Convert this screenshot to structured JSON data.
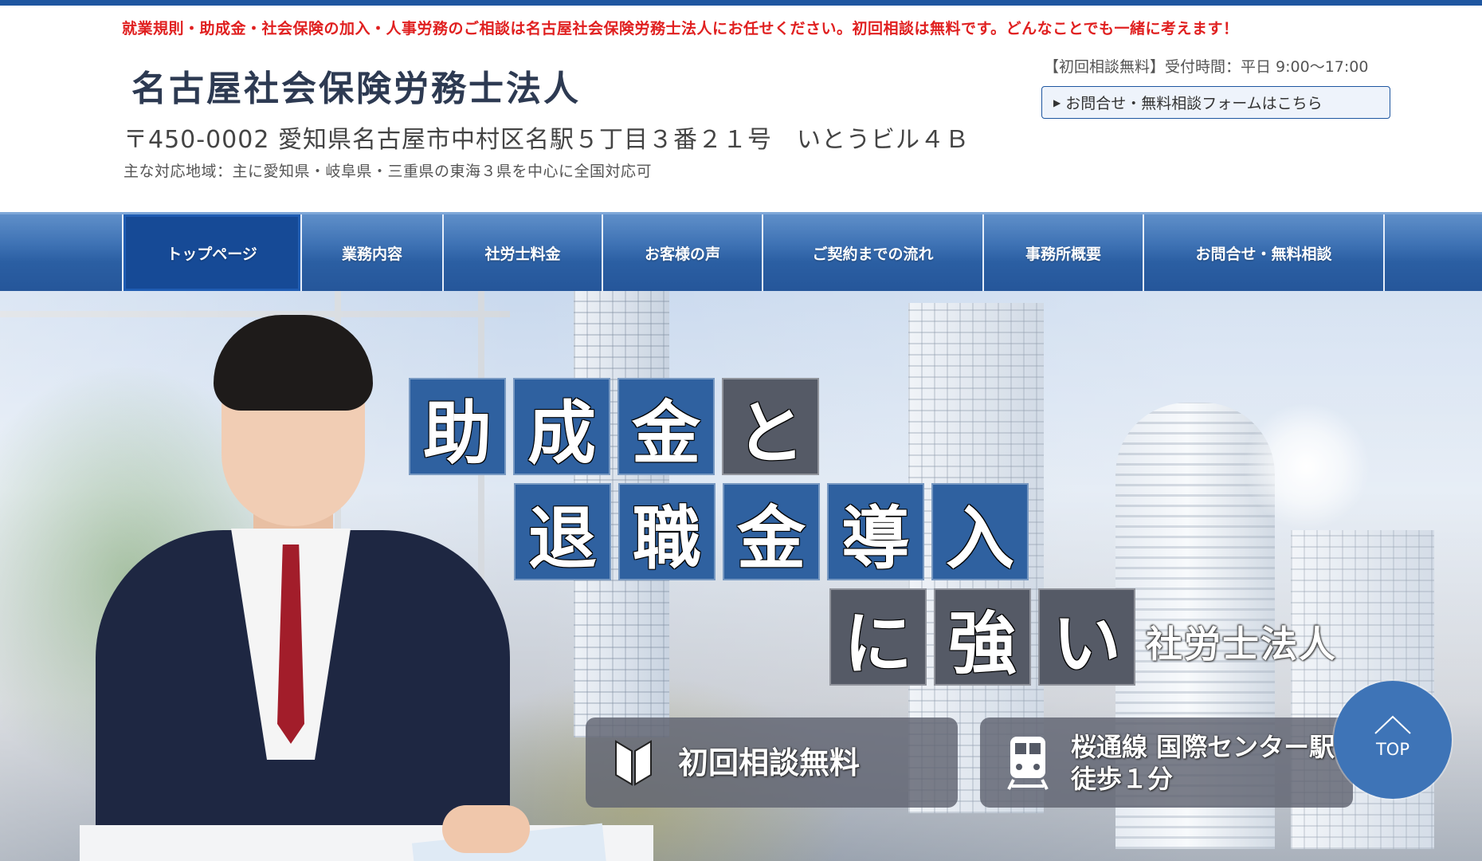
{
  "header": {
    "notice": "就業規則・助成金・社会保険の加入・人事労務のご相談は名古屋社会保険労務士法人にお任せください。初回相談は無料です。どんなことでも一緒に考えます！",
    "logo": "名古屋社会保険労務士法人",
    "address": "〒450-0002 愛知県名古屋市中村区名駅５丁目３番２１号　いとうビル４Ｂ",
    "area": "主な対応地域：主に愛知県・岐阜県・三重県の東海３県を中心に全国対応可",
    "hours": "【初回相談無料】受付時間：平日 9:00〜17:00",
    "contact_link": "お問合せ・無料相談フォームはこちら"
  },
  "nav": {
    "items": [
      {
        "label": "トップページ",
        "active": true
      },
      {
        "label": "業務内容"
      },
      {
        "label": "社労士料金"
      },
      {
        "label": "お客様の声"
      },
      {
        "label": "ご契約までの流れ"
      },
      {
        "label": "事務所概要"
      },
      {
        "label": "お問合せ・無料相談"
      }
    ]
  },
  "hero": {
    "headline_row1": [
      "助",
      "成",
      "金",
      "と"
    ],
    "headline_row2": [
      "退",
      "職",
      "金",
      "導",
      "入"
    ],
    "headline_row3": [
      "に",
      "強",
      "い"
    ],
    "tagline": "社労士法人",
    "badge_free": "初回相談無料",
    "badge_access_line1": "桜通線 国際センター駅",
    "badge_access_line2": "徒歩１分"
  },
  "top_button": {
    "label": "TOP"
  },
  "colors": {
    "accent": "#1e56a0",
    "notice_red": "#e02020",
    "nav_active": "#164a96",
    "tile_blue": "#2f61a0",
    "tile_gray": "#555a66"
  },
  "icons": [
    "beginner-mark-icon",
    "train-icon",
    "chevron-up-icon",
    "triangle-right-icon"
  ]
}
